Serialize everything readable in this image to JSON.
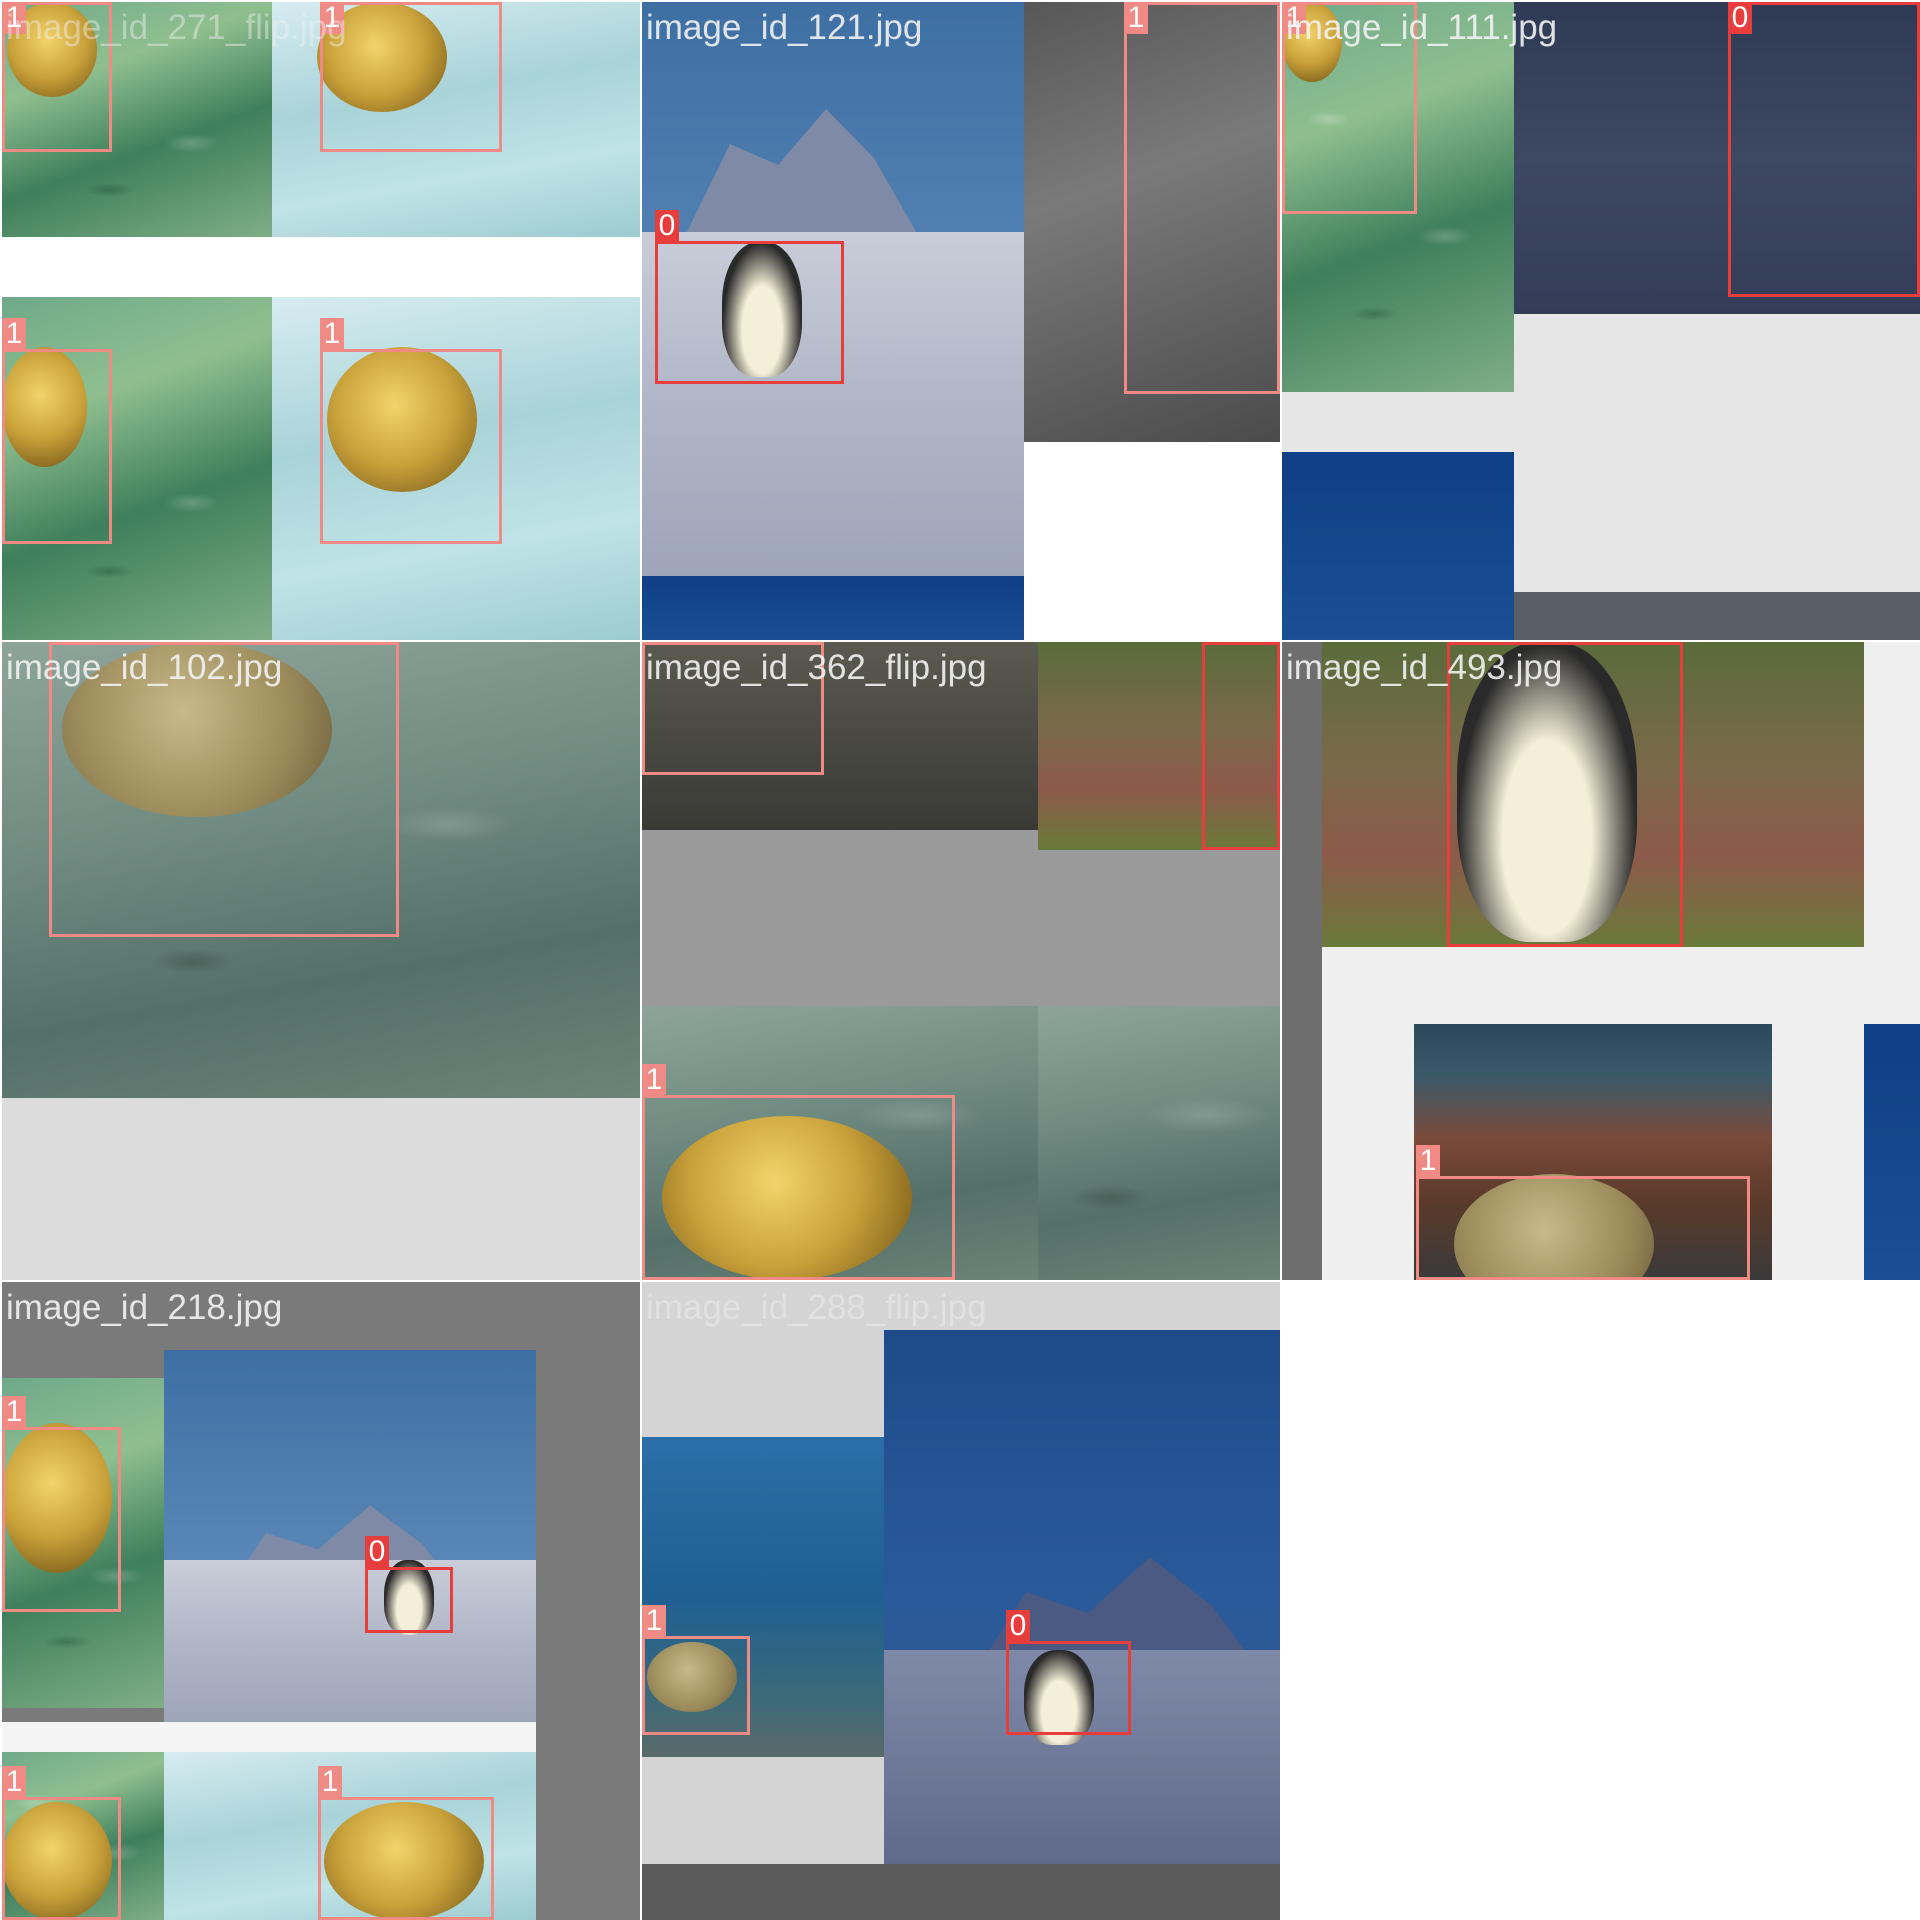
{
  "tiles": [
    {
      "title": "image_id_271_flip.jpg",
      "labels": [
        "1",
        "1",
        "1",
        "1"
      ]
    },
    {
      "title": "image_id_121.jpg",
      "labels": [
        "0",
        "1"
      ]
    },
    {
      "title": "image_id_111.jpg",
      "labels": [
        "1",
        "0"
      ]
    },
    {
      "title": "image_id_102.jpg",
      "labels": [
        "1"
      ]
    },
    {
      "title": "image_id_362_flip.jpg",
      "labels": [
        "1",
        "0",
        "1"
      ]
    },
    {
      "title": "image_id_493.jpg",
      "labels": [
        "0",
        "1"
      ]
    },
    {
      "title": "image_id_218.jpg",
      "labels": [
        "1",
        "0",
        "1",
        "1"
      ]
    },
    {
      "title": "image_id_288_flip.jpg",
      "labels": [
        "1",
        "0"
      ]
    }
  ],
  "colors": {
    "class_0": "#e83d3d",
    "class_1": "#f08a84"
  }
}
